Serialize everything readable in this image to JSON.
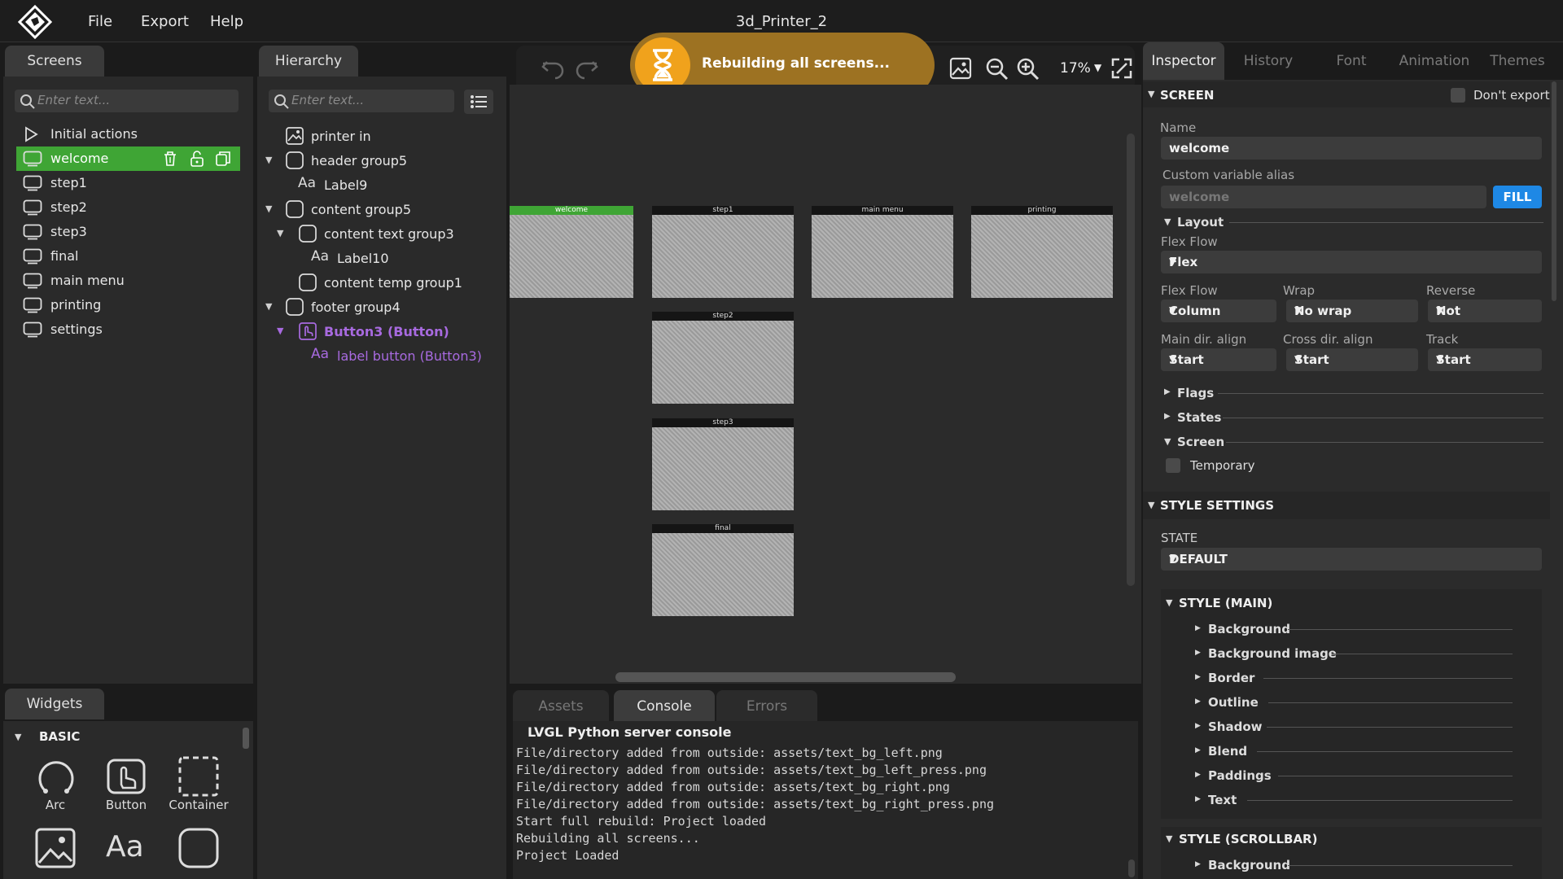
{
  "menubar": {
    "items": [
      "File",
      "Export",
      "Help"
    ],
    "title": "3d_Printer_2"
  },
  "screens_panel": {
    "tab": "Screens",
    "search_placeholder": "Enter text...",
    "initial_actions": "Initial actions",
    "items": [
      "welcome",
      "step1",
      "step2",
      "step3",
      "final",
      "main menu",
      "printing",
      "settings"
    ],
    "selected": "welcome"
  },
  "widgets_panel": {
    "tab": "Widgets",
    "section": "BASIC",
    "items": [
      "Arc",
      "Button",
      "Container"
    ]
  },
  "hierarchy_panel": {
    "tab": "Hierarchy",
    "search_placeholder": "Enter text...",
    "items": [
      {
        "label": "printer in",
        "icon": "image-icon"
      },
      {
        "label": "header group5",
        "icon": "container-icon"
      },
      {
        "label": "Label9",
        "icon": "label-icon"
      },
      {
        "label": "content group5",
        "icon": "container-icon"
      },
      {
        "label": "content text group3",
        "icon": "container-icon"
      },
      {
        "label": "Label10",
        "icon": "label-icon"
      },
      {
        "label": "content temp group1",
        "icon": "container-icon"
      },
      {
        "label": "footer group4",
        "icon": "container-icon"
      },
      {
        "label": "Button3 (Button)",
        "icon": "button-icon"
      },
      {
        "label": "label button (Button3)",
        "icon": "label-icon"
      }
    ]
  },
  "toolbar": {
    "zoom": "17%"
  },
  "toast": {
    "text": "Rebuilding all screens..."
  },
  "canvas": {
    "screens": [
      "welcome",
      "step1",
      "main menu",
      "printing",
      "step2",
      "step3",
      "final"
    ]
  },
  "bottom_panel": {
    "tabs": [
      "Assets",
      "Console",
      "Errors"
    ],
    "active_tab": "Console",
    "console_title": "LVGL Python server console",
    "lines": [
      "File/directory added from outside: assets/text_bg_left.png",
      "File/directory added from outside: assets/text_bg_left_press.png",
      "File/directory added from outside: assets/text_bg_right.png",
      "File/directory added from outside: assets/text_bg_right_press.png",
      "Start full rebuild: Project loaded",
      "Rebuilding all screens...",
      "Project Loaded"
    ]
  },
  "inspector": {
    "tabs": [
      "Inspector",
      "History",
      "Font",
      "Animation",
      "Themes"
    ],
    "screen_section": "SCREEN",
    "dont_export": "Don't export",
    "name_label": "Name",
    "name_value": "welcome",
    "alias_label": "Custom variable alias",
    "alias_placeholder": "welcome",
    "fill_button": "FILL",
    "layout_head": "Layout",
    "flex_flow_label": "Flex Flow",
    "flex_flow_value": "Flex",
    "flex_flow2_label": "Flex Flow",
    "flex_flow2_value": "Column",
    "wrap_label": "Wrap",
    "wrap_value": "No wrap",
    "reverse_label": "Reverse",
    "reverse_value": "Not",
    "main_align_label": "Main dir. align",
    "main_align_value": "Start",
    "cross_align_label": "Cross dir. align",
    "cross_align_value": "Start",
    "track_label": "Track",
    "track_value": "Start",
    "flags_head": "Flags",
    "states_head": "States",
    "screen_head": "Screen",
    "temporary_label": "Temporary",
    "style_settings": "STYLE SETTINGS",
    "state_label": "STATE",
    "state_value": "DEFAULT",
    "style_main": "STYLE (MAIN)",
    "style_main_items": [
      "Background",
      "Background image",
      "Border",
      "Outline",
      "Shadow",
      "Blend",
      "Paddings",
      "Text"
    ],
    "style_scrollbar": "STYLE (SCROLLBAR)",
    "style_scrollbar_items": [
      "Background"
    ]
  },
  "colors": {
    "accent_green": "#3fa535",
    "toast_bg": "#9d7222",
    "fill_blue": "#1e88e5",
    "selected_purple": "#a86ae0"
  }
}
